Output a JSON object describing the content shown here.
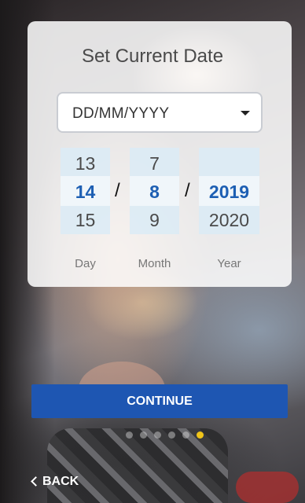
{
  "header": {
    "title": "Set Current Date"
  },
  "date_format": {
    "selected": "DD/MM/YYYY"
  },
  "picker": {
    "day": {
      "prev": "13",
      "current": "14",
      "next": "15",
      "label": "Day"
    },
    "month": {
      "prev": "7",
      "current": "8",
      "next": "9",
      "label": "Month"
    },
    "year": {
      "prev": "",
      "current": "2019",
      "next": "2020",
      "label": "Year"
    },
    "separator": "/"
  },
  "actions": {
    "continue_label": "CONTINUE",
    "back_label": "BACK"
  },
  "pagination": {
    "total": 6,
    "active_index": 5
  },
  "colors": {
    "accent": "#1e56b2",
    "selected_value": "#1d5fb3",
    "active_dot": "#f0c419"
  }
}
